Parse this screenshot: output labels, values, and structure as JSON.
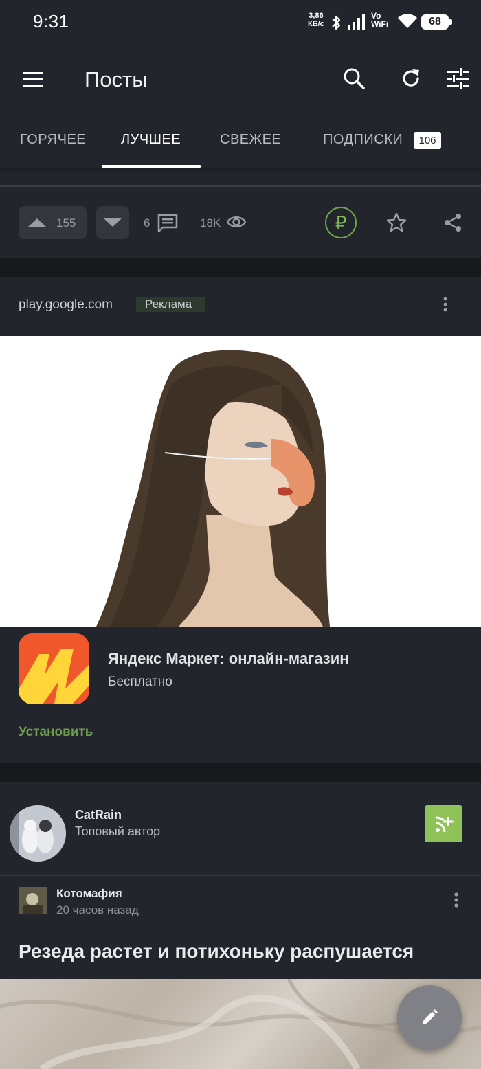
{
  "status_bar": {
    "time": "9:31",
    "net_speed_value": "3,86",
    "net_speed_unit": "КБ/с",
    "vowifi_top": "Vo",
    "vowifi_bottom": "WiFi",
    "battery": "68"
  },
  "app_bar": {
    "title": "Посты",
    "icons": [
      "menu-icon",
      "search-icon",
      "refresh-icon",
      "filter-icon"
    ]
  },
  "tabs": {
    "items": [
      {
        "label": "ГОРЯЧЕЕ",
        "active": false
      },
      {
        "label": "ЛУЧШЕЕ",
        "active": true
      },
      {
        "label": "СВЕЖЕЕ",
        "active": false
      },
      {
        "label": "ПОДПИСКИ",
        "active": false,
        "badge": "106"
      }
    ]
  },
  "post_actions": {
    "upvotes": "155",
    "comments": "6",
    "views": "18K",
    "donate_symbol": "₽"
  },
  "ad": {
    "source": "play.google.com",
    "label": "Реклама",
    "app_name": "Яндекс Маркет: онлайн-магазин",
    "price": "Бесплатно",
    "install": "Установить"
  },
  "author": {
    "name": "CatRain",
    "role": "Топовый автор"
  },
  "post": {
    "community": "Котомафия",
    "time_ago": "20 часов назад",
    "title": "Резеда растет и потихоньку распушается"
  },
  "colors": {
    "background": "#22252b",
    "separator": "#17191c",
    "accent_green": "#8fc35a",
    "install_green": "#6c9c4e",
    "yandex_orange": "#f0572a",
    "yandex_yellow": "#ffd53a"
  }
}
